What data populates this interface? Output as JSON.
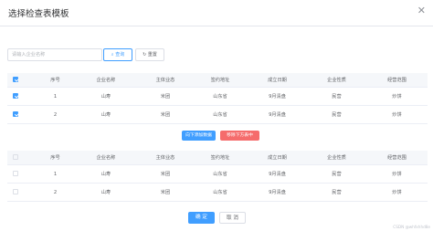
{
  "dialog": {
    "title": "选择检查表模板",
    "close": "✕"
  },
  "search": {
    "placeholder": "请输入企业名称",
    "search_label": "查询",
    "reset_label": "重置"
  },
  "columns": [
    "序号",
    "企业名称",
    "主体业态",
    "签约地址",
    "成立日期",
    "企业性质",
    "经营范围"
  ],
  "top_table": {
    "header_checked": true,
    "rows": [
      {
        "checked": true,
        "cells": [
          "1",
          "山寿",
          "米团",
          "山东省",
          "9月清盘",
          "民营",
          "炒饼"
        ]
      },
      {
        "checked": true,
        "cells": [
          "2",
          "山寿",
          "米团",
          "山东省",
          "9月清盘",
          "民营",
          "炒饼"
        ]
      }
    ]
  },
  "actions": {
    "add_label": "向下添加数据",
    "remove_label": "移除下方表中"
  },
  "bottom_table": {
    "header_checked": false,
    "rows": [
      {
        "checked": false,
        "cells": [
          "1",
          "山寿",
          "米团",
          "山东省",
          "9月清盘",
          "民营",
          "炒饼"
        ]
      },
      {
        "checked": false,
        "cells": [
          "2",
          "山寿",
          "米团",
          "山东省",
          "9月清盘",
          "民营",
          "炒饼"
        ]
      }
    ]
  },
  "footer": {
    "confirm_label": "确 定",
    "cancel_label": "取 消"
  },
  "watermark": "CSDN @whfxhhd8e"
}
